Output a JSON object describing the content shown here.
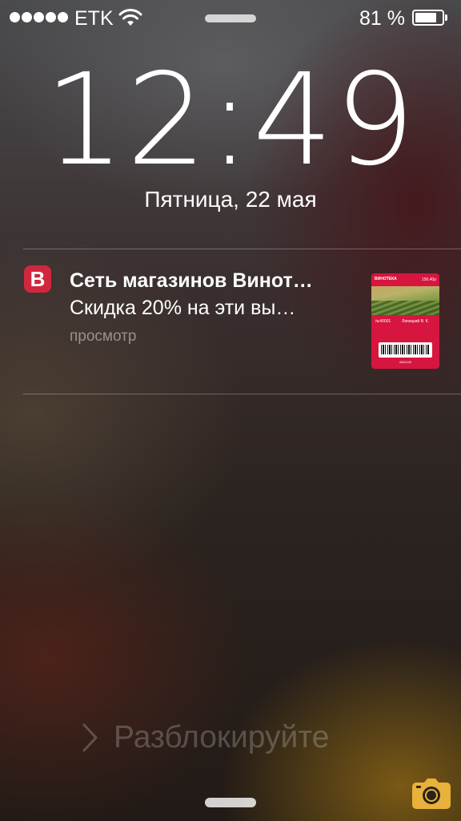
{
  "status_bar": {
    "signal_dots": 5,
    "carrier": "ETK",
    "wifi_icon": "wifi-icon",
    "battery_percent": "81 %",
    "battery_level": 0.81
  },
  "lock_screen": {
    "time": "12:49",
    "date": "Пятница, 22 мая"
  },
  "notification": {
    "app_icon_letter": "B",
    "app_icon_color": "#d0273f",
    "title": "Сеть магазинов Винот…",
    "body": "Скидка 20% на эти вы…",
    "action": "просмотр",
    "thumbnail": {
      "logo": "ВИНОТЕКА",
      "price": "150.40р",
      "card_label": "№40001",
      "owner": "Лапицкий В. К.",
      "code": "4000100",
      "color": "#d6163f"
    }
  },
  "unlock": {
    "label": "Разблокируйте"
  },
  "icons": {
    "chevron": "chevron-right-icon",
    "camera": "camera-icon"
  }
}
